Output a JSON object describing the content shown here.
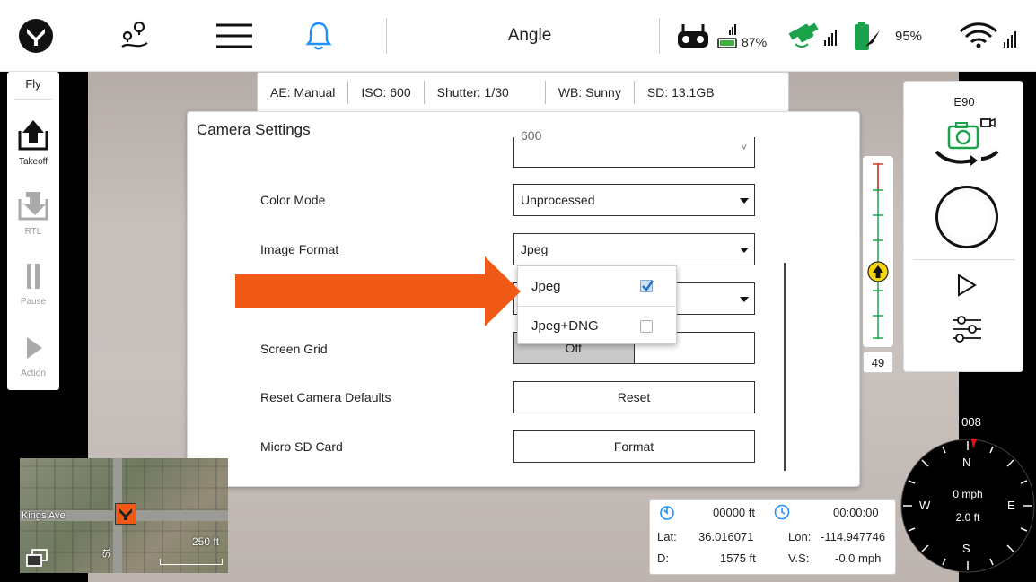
{
  "topbar": {
    "title": "Angle",
    "controller_battery": "87%",
    "drone_battery": "95%"
  },
  "leftpanel": {
    "mode": "Fly",
    "takeoff": "Takeoff",
    "rtl": "RTL",
    "pause": "Pause",
    "action": "Action"
  },
  "status": {
    "ae": "AE:  Manual",
    "iso": "ISO:  600",
    "shutter": "Shutter:  1/30",
    "wb": "WB:  Sunny",
    "sd": "SD:  13.1GB"
  },
  "dialog": {
    "title": "Camera Settings",
    "iso_value": "600",
    "color_mode_label": "Color Mode",
    "color_mode_value": "Unprocessed",
    "image_format_label": "Image Format",
    "image_format_value": "Jpeg",
    "screen_grid_label": "Screen Grid",
    "screen_grid_value": "Off",
    "reset_label": "Reset Camera Defaults",
    "reset_button": "Reset",
    "sd_label": "Micro SD Card",
    "format_button": "Format"
  },
  "dropdown": {
    "options": [
      {
        "label": "Jpeg",
        "checked": true
      },
      {
        "label": "Jpeg+DNG",
        "checked": false
      }
    ]
  },
  "rightpanel": {
    "camera_model": "E90"
  },
  "zoom": {
    "value": "49"
  },
  "map": {
    "street": "Kings Ave",
    "scale": "250 ft",
    "side_street": "St"
  },
  "telemetry": {
    "altitude": "00000 ft",
    "flight_time": "00:00:00",
    "lat_label": "Lat:",
    "lat": "36.016071",
    "lon_label": "Lon:",
    "lon": "-114.947746",
    "d_label": "D:",
    "distance": "1575 ft",
    "vs_label": "V.S:",
    "vs": "-0.0 mph"
  },
  "compass": {
    "heading": "008",
    "speed": "0 mph",
    "height": "2.0 ft",
    "n": "N",
    "s": "S",
    "e": "E",
    "w": "W"
  },
  "colors": {
    "accent_orange": "#f15a16",
    "accent_blue": "#1e90ff",
    "gps_green": "#1aa34a"
  }
}
